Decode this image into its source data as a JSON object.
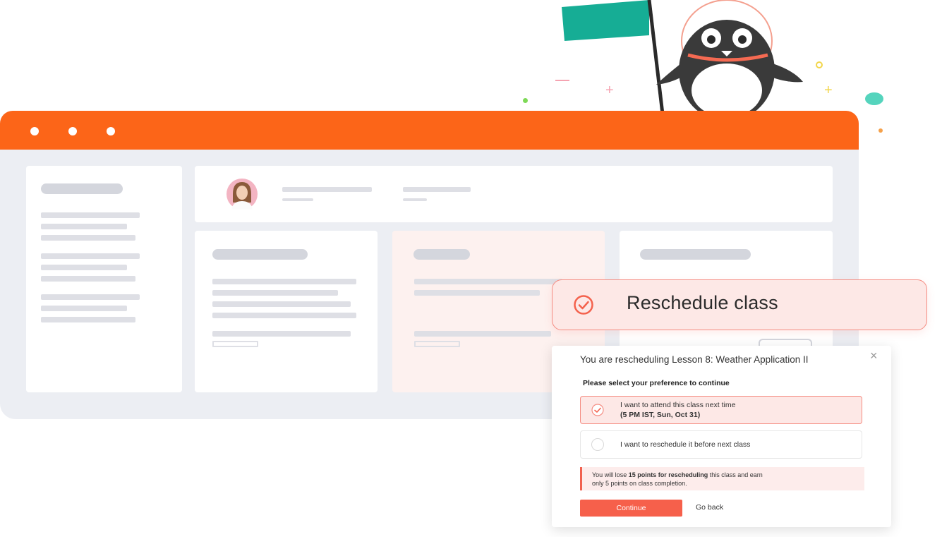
{
  "banner": {
    "title": "Reschedule class",
    "icon": "check-circle-icon"
  },
  "modal": {
    "title": "You are rescheduling Lesson 8: Weather Application II",
    "close_symbol": "×",
    "subtitle": "Please select your preference to continue",
    "options": [
      {
        "label": "I want to attend this class next time",
        "detail": "(5 PM IST, Sun, Oct 31)",
        "selected": true
      },
      {
        "label": "I want to reschedule it before next class",
        "selected": false
      }
    ],
    "warning": {
      "prefix": "You will lose ",
      "bold": "15 points for rescheduling",
      "suffix": " this class and earn",
      "line2": "only 5 points on class completion."
    },
    "continue_label": "Continue",
    "goback_label": "Go back"
  },
  "colors": {
    "accent": "#fc6518",
    "coral": "#f6604b",
    "flag": "#16ad95",
    "panel_bg": "#eceef3"
  }
}
